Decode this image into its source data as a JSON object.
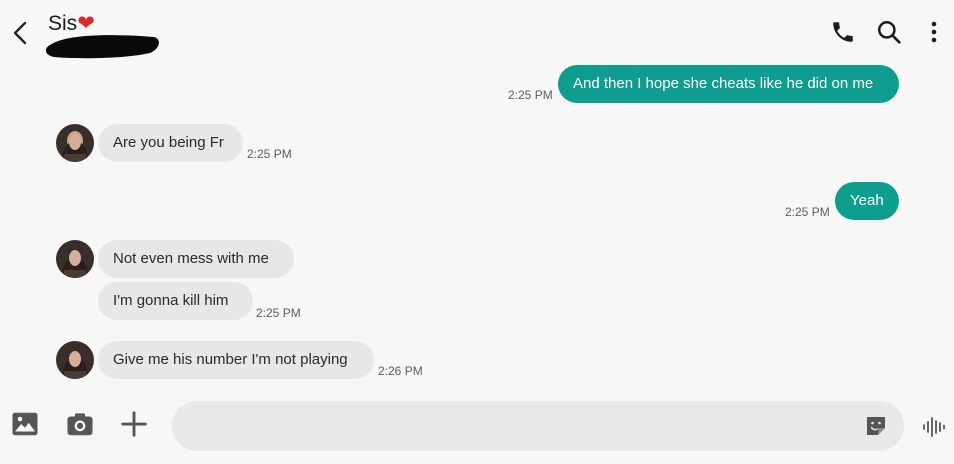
{
  "header": {
    "contact_name": "Sis",
    "contact_emoji": "❤"
  },
  "messages": [
    {
      "direction": "outgoing",
      "text": "And then I hope she cheats like he did on me",
      "time": "2:25 PM"
    },
    {
      "direction": "incoming",
      "text": "Are you being Fr",
      "time": "2:25 PM"
    },
    {
      "direction": "outgoing",
      "text": "Yeah",
      "time": "2:25 PM"
    },
    {
      "direction": "incoming",
      "text": "Not even mess with me",
      "time": ""
    },
    {
      "direction": "incoming",
      "text": "I'm gonna kill him",
      "time": "2:25 PM"
    },
    {
      "direction": "incoming",
      "text": "Give me his number I'm not playing",
      "time": "2:26 PM"
    }
  ],
  "composer": {
    "placeholder": "",
    "value": ""
  },
  "colors": {
    "outgoing_bubble": "#0e9d8e",
    "incoming_bubble": "#e7e7e7",
    "background": "#f7f7f7"
  },
  "icons": [
    "back-arrow-icon",
    "phone-icon",
    "search-icon",
    "more-vert-icon",
    "gallery-icon",
    "camera-icon",
    "plus-icon",
    "sticker-icon",
    "voice-icon"
  ]
}
